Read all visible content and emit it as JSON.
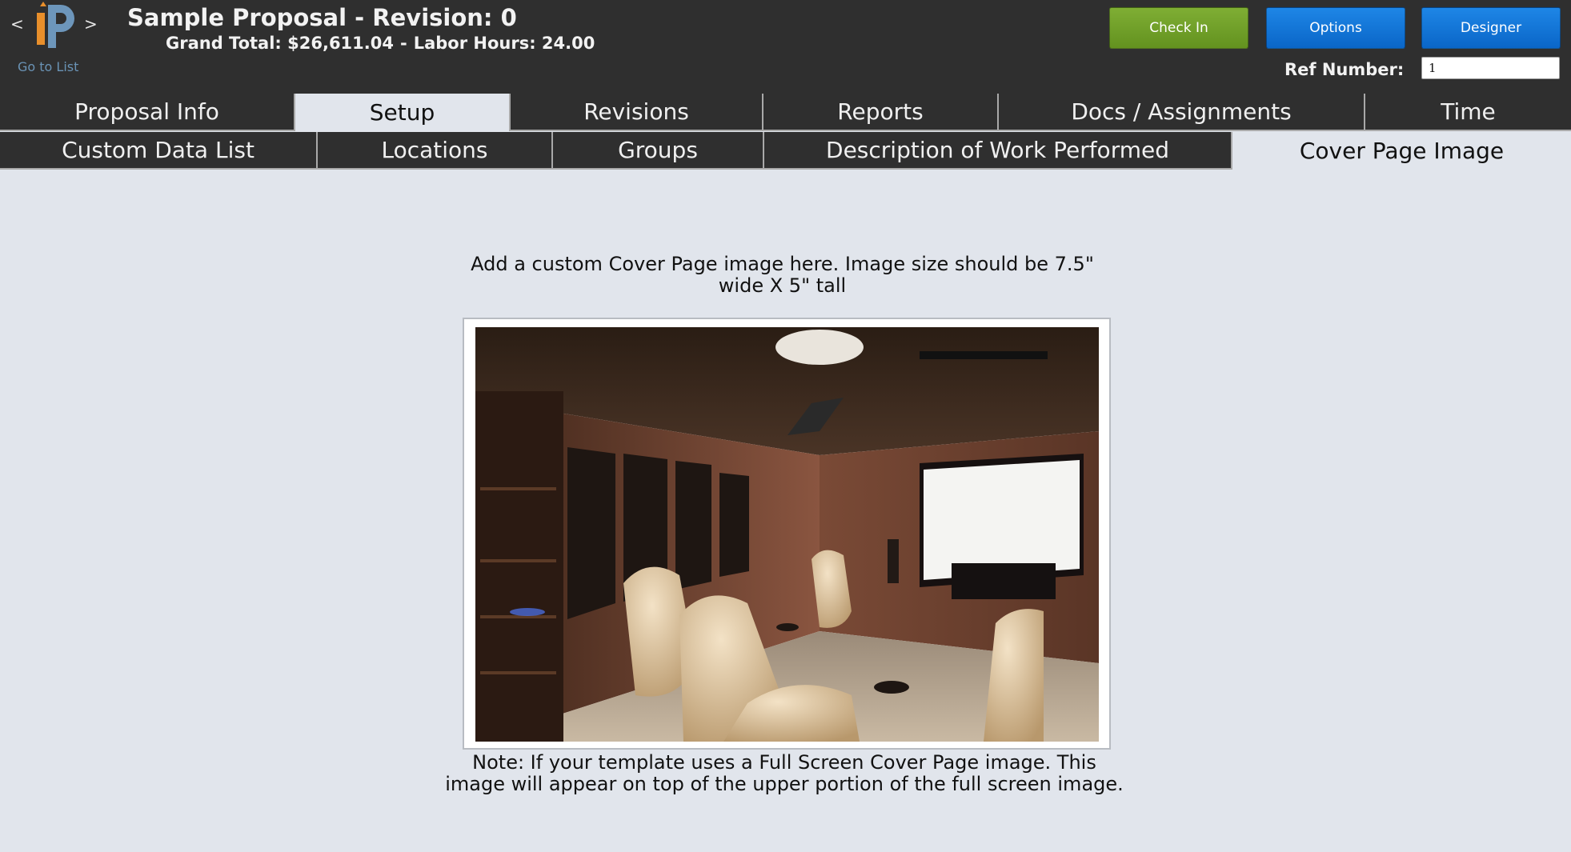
{
  "header": {
    "nav_prev": "<",
    "nav_next": ">",
    "logo_icon": "ip-logo-icon",
    "go_to_list": "Go to List",
    "title": "Sample Proposal - Revision: 0",
    "grand_total_label": "Grand Total: $26,611.04",
    "separator": "-",
    "labor_hours_label": "Labor Hours: 24.00",
    "buttons": {
      "check_in": "Check In",
      "options": "Options",
      "designer": "Designer"
    },
    "ref_number_label": "Ref Number:",
    "ref_number_value": "1"
  },
  "tabs_primary": [
    {
      "label": "Proposal Info",
      "active": false
    },
    {
      "label": "Setup",
      "active": true
    },
    {
      "label": "Revisions",
      "active": false
    },
    {
      "label": "Reports",
      "active": false
    },
    {
      "label": "Docs / Assignments",
      "active": false
    },
    {
      "label": "Time",
      "active": false
    }
  ],
  "tabs_secondary": [
    {
      "label": "Custom Data List",
      "active": false
    },
    {
      "label": "Locations",
      "active": false
    },
    {
      "label": "Groups",
      "active": false
    },
    {
      "label": "Description of Work Performed",
      "active": false
    },
    {
      "label": "Cover Page Image",
      "active": true
    }
  ],
  "content": {
    "instruction": "Add a custom Cover Page image here. Image size should be 7.5\" wide X 5\" tall",
    "note": "Note: If your template uses a Full Screen Cover Page image. This image will appear on top of the upper portion of the full screen image."
  },
  "colors": {
    "header_bg": "#2f2f2f",
    "page_bg": "#e1e5ec",
    "check_in": "#6fa02a",
    "options": "#0f72d6",
    "designer": "#0f72d6",
    "link": "#6a93b5"
  }
}
